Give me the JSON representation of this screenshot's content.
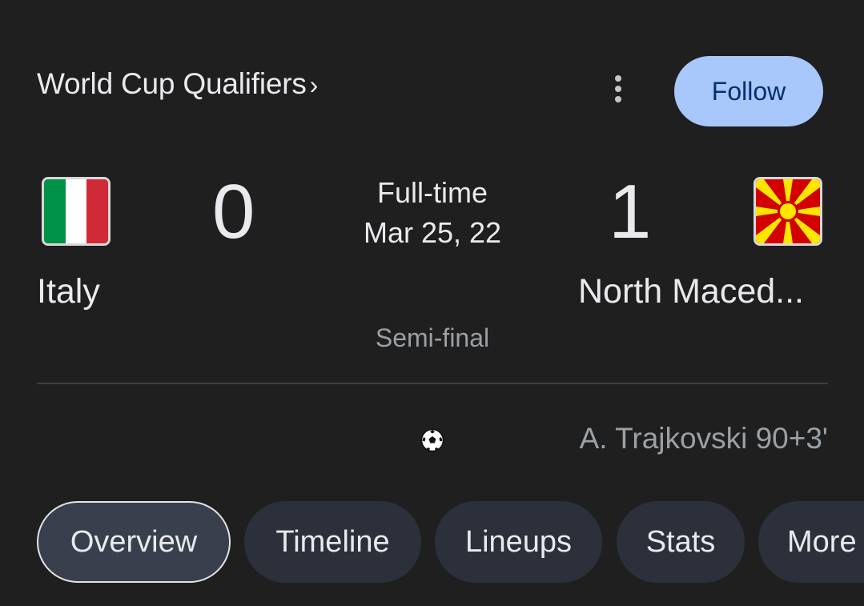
{
  "header": {
    "competition": "World Cup Qualifiers",
    "chevron": "›",
    "follow_label": "Follow",
    "menu_icon": "more-vert-icon"
  },
  "match": {
    "home": {
      "name": "Italy",
      "score": "0",
      "flag_icon": "italy-flag-icon"
    },
    "away": {
      "name": "North Maced...",
      "score": "1",
      "flag_icon": "north-macedonia-flag-icon"
    },
    "status": "Full-time",
    "date": "Mar 25, 22",
    "stage": "Semi-final"
  },
  "events": [
    {
      "icon": "soccer-ball-icon",
      "text": "A. Trajkovski 90+3'"
    }
  ],
  "tabs": [
    {
      "label": "Overview",
      "active": true
    },
    {
      "label": "Timeline",
      "active": false
    },
    {
      "label": "Lineups",
      "active": false
    },
    {
      "label": "Stats",
      "active": false
    },
    {
      "label": "More",
      "active": false
    }
  ],
  "colors": {
    "background": "#1f1f1f",
    "follow_bg": "#a8c7fa",
    "follow_text": "#062e6f",
    "tab_bg": "#2b303b",
    "italy": [
      "#009246",
      "#ffffff",
      "#ce2b37"
    ],
    "macedonia_red": "#d20000",
    "macedonia_yellow": "#ffe600"
  }
}
